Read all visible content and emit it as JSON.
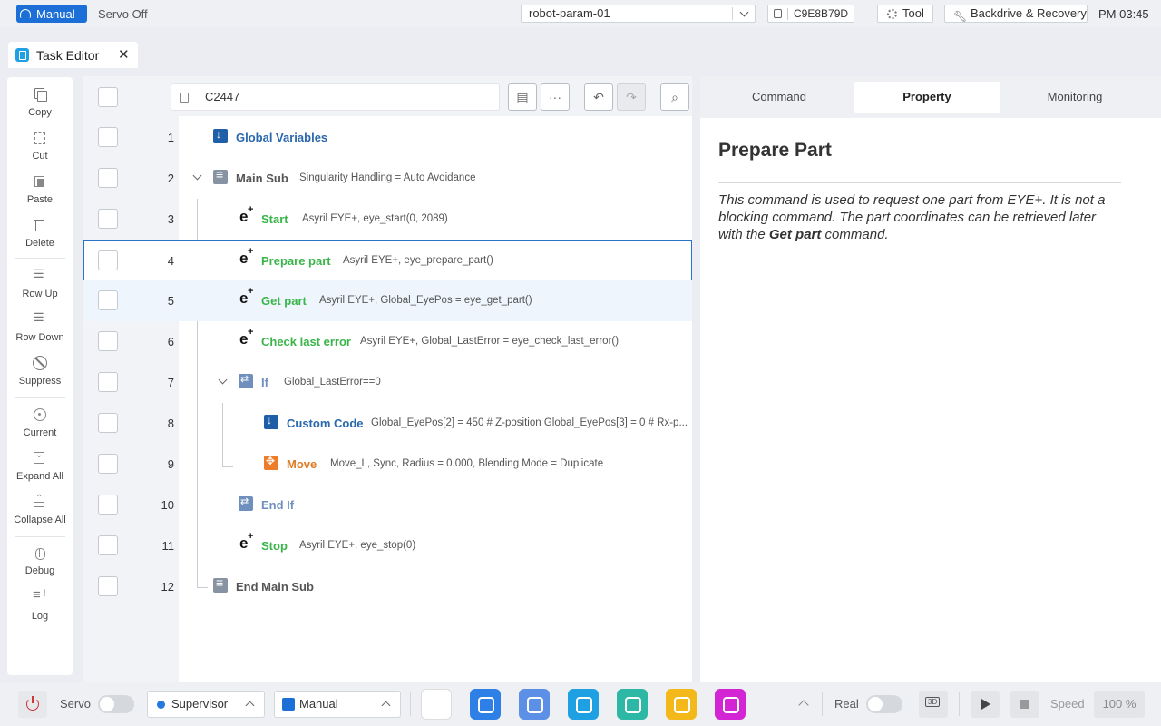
{
  "topbar": {
    "mode": "Manual",
    "servo_status": "Servo Off",
    "param_file": "robot-param-01",
    "device_id": "C9E8B79D",
    "tool_label": "Tool",
    "backdrive_label": "Backdrive & Recovery",
    "time": "PM 03:45"
  },
  "tab": {
    "title": "Task Editor"
  },
  "left_tools": [
    {
      "label": "Copy",
      "icon": "copy-icon"
    },
    {
      "label": "Cut",
      "icon": "cut-icon"
    },
    {
      "label": "Paste",
      "icon": "paste-icon"
    },
    {
      "label": "Delete",
      "icon": "delete-icon"
    },
    {
      "label": "Row Up",
      "icon": "row-up-icon"
    },
    {
      "label": "Row Down",
      "icon": "row-down-icon"
    },
    {
      "label": "Suppress",
      "icon": "suppress-icon"
    },
    {
      "label": "Current",
      "icon": "current-icon"
    },
    {
      "label": "Expand All",
      "icon": "expand-all-icon"
    },
    {
      "label": "Collapse All",
      "icon": "collapse-all-icon"
    },
    {
      "label": "Debug",
      "icon": "debug-icon"
    },
    {
      "label": "Log",
      "icon": "log-icon"
    }
  ],
  "editor": {
    "file_name": "C2447",
    "rows": [
      {
        "num": "1",
        "cmd": "Global Variables",
        "args": ""
      },
      {
        "num": "2",
        "cmd": "Main Sub",
        "args": "Singularity Handling = Auto Avoidance"
      },
      {
        "num": "3",
        "cmd": "Start",
        "args": "Asyril EYE+, eye_start(0, 2089)"
      },
      {
        "num": "4",
        "cmd": "Prepare part",
        "args": "Asyril EYE+, eye_prepare_part()"
      },
      {
        "num": "5",
        "cmd": "Get part",
        "args": "Asyril EYE+, Global_EyePos = eye_get_part()"
      },
      {
        "num": "6",
        "cmd": "Check last error",
        "args": "Asyril EYE+, Global_LastError = eye_check_last_error()"
      },
      {
        "num": "7",
        "cmd": "If",
        "args": "Global_LastError==0"
      },
      {
        "num": "8",
        "cmd": "Custom Code",
        "args": "Global_EyePos[2] = 450 # Z-position Global_EyePos[3] = 0 # Rx-p..."
      },
      {
        "num": "9",
        "cmd": "Move",
        "args": "Move_L, Sync, Radius = 0.000, Blending Mode = Duplicate"
      },
      {
        "num": "10",
        "cmd": "End If",
        "args": ""
      },
      {
        "num": "11",
        "cmd": "Stop",
        "args": "Asyril EYE+, eye_stop(0)"
      },
      {
        "num": "12",
        "cmd": "End Main Sub",
        "args": ""
      }
    ]
  },
  "right_panel": {
    "tabs": [
      "Command",
      "Property",
      "Monitoring"
    ],
    "active_tab": "Property",
    "title": "Prepare Part",
    "desc_1": "This command is used to request one part from EYE+. It is not a blocking command. The part coordinates can be retrieved later with the ",
    "desc_bold": "Get part",
    "desc_2": " command."
  },
  "bottombar": {
    "servo_label": "Servo",
    "user_level": "Supervisor",
    "mode": "Manual",
    "real_label": "Real",
    "speed_label": "Speed",
    "speed_value": "100 %"
  },
  "colors": {
    "accent": "#1b6fd6",
    "selection": "#2a73c8",
    "eye_cmd": "#3ab54a",
    "blue_cmd": "#2a68ad",
    "move_cmd": "#e07b24",
    "power": "#d0343c"
  }
}
